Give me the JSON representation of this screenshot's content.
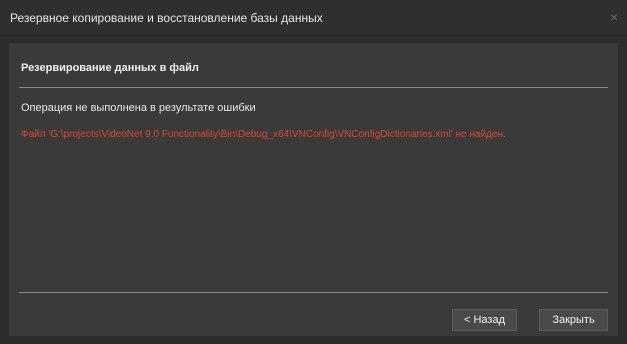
{
  "window": {
    "title": "Резервное копирование и восстановление базы данных",
    "close_glyph": "×"
  },
  "content": {
    "section_title": "Резервирование данных в файл",
    "status": "Операция не выполнена в результате ошибки",
    "error": "Файл 'G:\\projects\\VideoNet 9.0 Functionality\\Bin\\Debug_x64\\VNConfig\\VNConfigDictionaries.xml' не найден."
  },
  "buttons": {
    "back_label": "< Назад",
    "close_label": "Закрыть"
  },
  "colors": {
    "error_text": "#e0452b",
    "panel_background": "#3a3a3a",
    "window_background": "#2d2d2d"
  },
  "icons": {
    "close": "close-icon"
  }
}
